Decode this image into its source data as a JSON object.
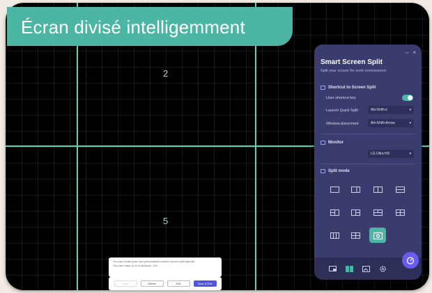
{
  "banner": {
    "title": "Écran divisé intelligemment"
  },
  "zones": {
    "top_number": "2",
    "bottom_number": "5"
  },
  "dialog": {
    "line1": "You can create your own personalized custom screen split layouts.",
    "line2": "You can make up to 6 windows. 12h",
    "buttons": [
      {
        "label": "Undo"
      },
      {
        "label": "Delete"
      },
      {
        "label": "Exit"
      },
      {
        "label": "Save & Exit"
      }
    ]
  },
  "panel": {
    "title": "Smart Screen Split",
    "subtitle": "Split your screen for work environment.",
    "window_controls": {
      "minimize": "–",
      "close": "×"
    },
    "shortcut_section": {
      "title": "Shortcut to Screen Split",
      "user_shortcut_label": "User shortcut key",
      "toggle_on": true,
      "launch_label": "Launch Quick Split",
      "launch_value": "Alt+Shift+L",
      "placement_label": "Window placement",
      "placement_value": "Alt+Shift+Arrow"
    },
    "monitor_section": {
      "title": "Monitor",
      "monitor_value": "LG Ultra HD"
    },
    "split_section": {
      "title": "Split mode"
    }
  },
  "icons": {
    "dropdown": "chevron-down-icon",
    "fab": "timer-icon"
  },
  "colors": {
    "accent": "#4db5a4",
    "panel": "#3a3c6e",
    "primary_button": "#4f57d8"
  }
}
